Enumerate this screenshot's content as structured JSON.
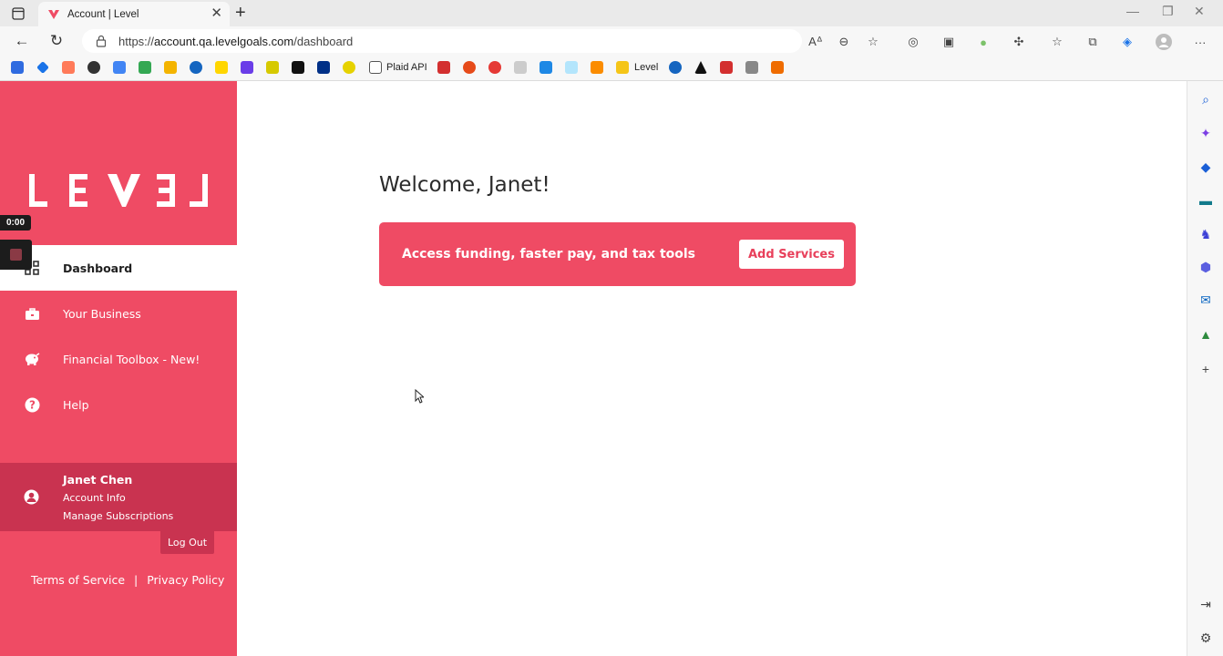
{
  "browser": {
    "tab_title": "Account | Level",
    "url_prefix": "https://",
    "url_domain": "account.qa.levelgoals.com",
    "url_path": "/dashboard",
    "bookmarks": {
      "plaid_label": "Plaid API",
      "level_label": "Level"
    }
  },
  "recorder": {
    "timer": "0:00"
  },
  "sidebar": {
    "brand": "LEVEL",
    "nav": [
      {
        "label": "Dashboard",
        "icon": "dashboard-grid-icon"
      },
      {
        "label": "Your Business",
        "icon": "briefcase-icon"
      },
      {
        "label": "Financial Toolbox - New!",
        "icon": "piggy-bank-icon"
      },
      {
        "label": "Help",
        "icon": "question-circle-icon"
      }
    ],
    "account": {
      "name": "Janet Chen",
      "info_link": "Account Info",
      "subs_link": "Manage Subscriptions"
    },
    "logout": "Log Out",
    "legal": {
      "terms": "Terms of Service",
      "separator": "|",
      "privacy": "Privacy Policy"
    }
  },
  "main": {
    "welcome": "Welcome, Janet!",
    "banner": {
      "text": "Access funding, faster pay, and tax tools",
      "button": "Add Services"
    }
  },
  "colors": {
    "brand_pink": "#ef4b64",
    "account_dark_pink": "#c93350"
  }
}
